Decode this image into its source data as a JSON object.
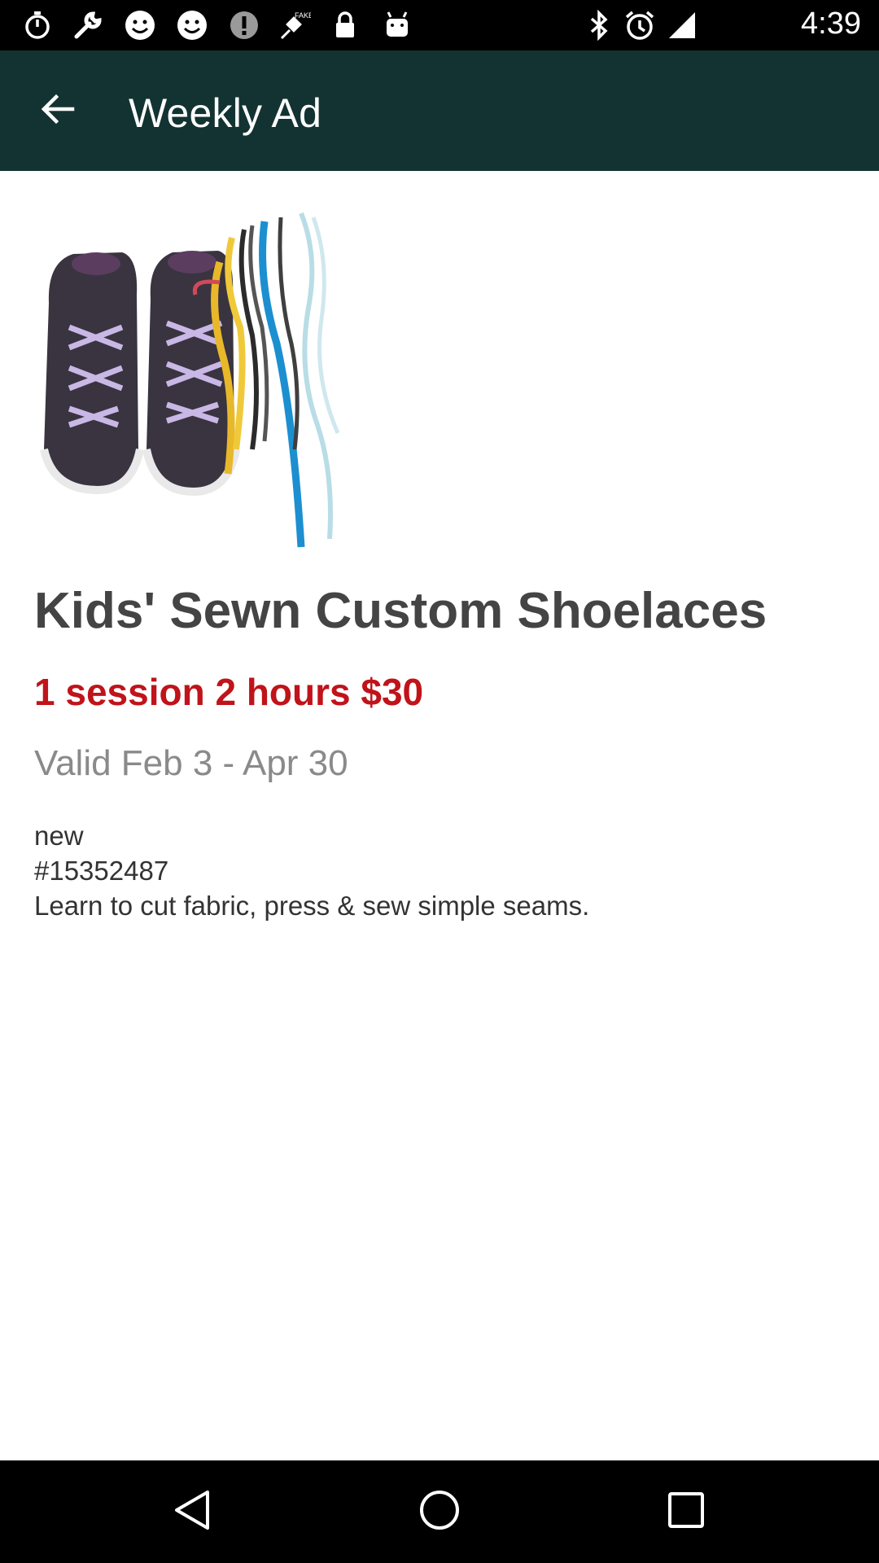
{
  "status_bar": {
    "time": "4:39",
    "left_icons": [
      "stopwatch-icon",
      "wrench-icon",
      "smiley-icon",
      "smiley-icon",
      "info-icon",
      "satellite-icon",
      "lock-icon",
      "android-icon"
    ],
    "right_icons": [
      "bluetooth-icon",
      "alarm-icon",
      "signal-icon"
    ]
  },
  "app_bar": {
    "title": "Weekly Ad",
    "back_icon": "arrow-back-icon",
    "color": "#123331"
  },
  "product": {
    "image": "shoes-with-shoelaces-image",
    "title": "Kids' Sewn Custom Shoelaces",
    "price_line": "1 session 2 hours $30",
    "price_color": "#c0131a",
    "validity": "Valid Feb 3 - Apr 30",
    "description_lines": [
      "new",
      "#15352487",
      "Learn to cut fabric, press & sew simple seams."
    ]
  },
  "nav_bar": {
    "buttons": [
      "back-triangle-icon",
      "home-circle-icon",
      "recents-square-icon"
    ]
  }
}
